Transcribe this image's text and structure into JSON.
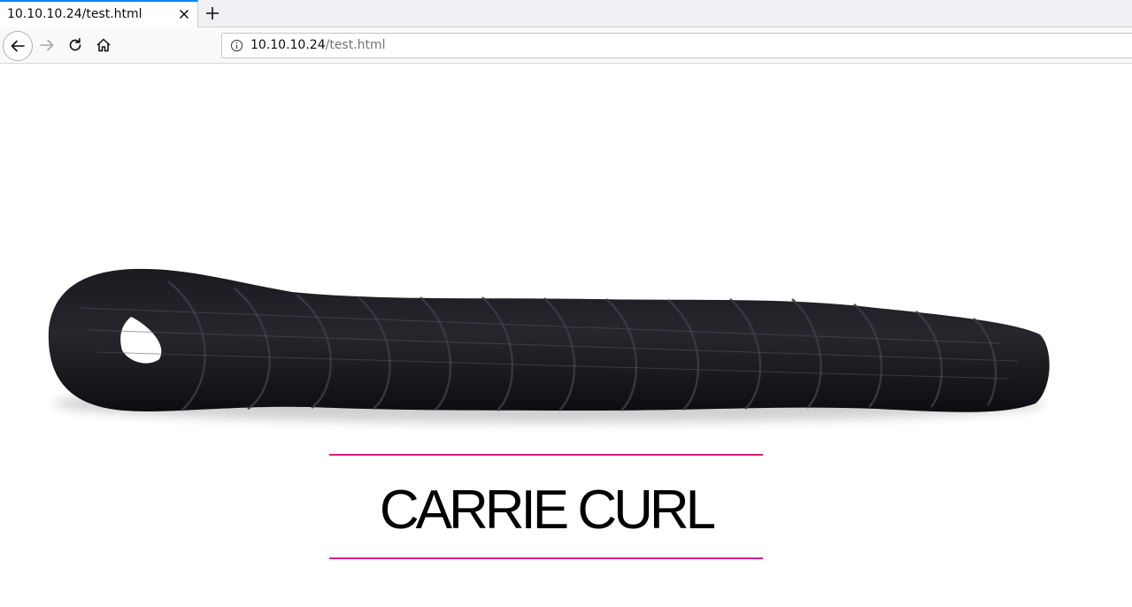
{
  "browser": {
    "tab": {
      "title": "10.10.10.24/test.html"
    },
    "address_bar": {
      "host": "10.10.10.24",
      "path": "/test.html"
    },
    "accent_color": "#0a84ff",
    "icons": [
      "close-icon",
      "plus-icon",
      "back-arrow-icon",
      "forward-arrow-icon",
      "reload-icon",
      "home-icon",
      "info-icon"
    ]
  },
  "page": {
    "product": {
      "name": "CARRIE CURL",
      "image": "black curly braided hair extension",
      "rule_color": "#e0188c",
      "hair_color": "#121217"
    }
  }
}
